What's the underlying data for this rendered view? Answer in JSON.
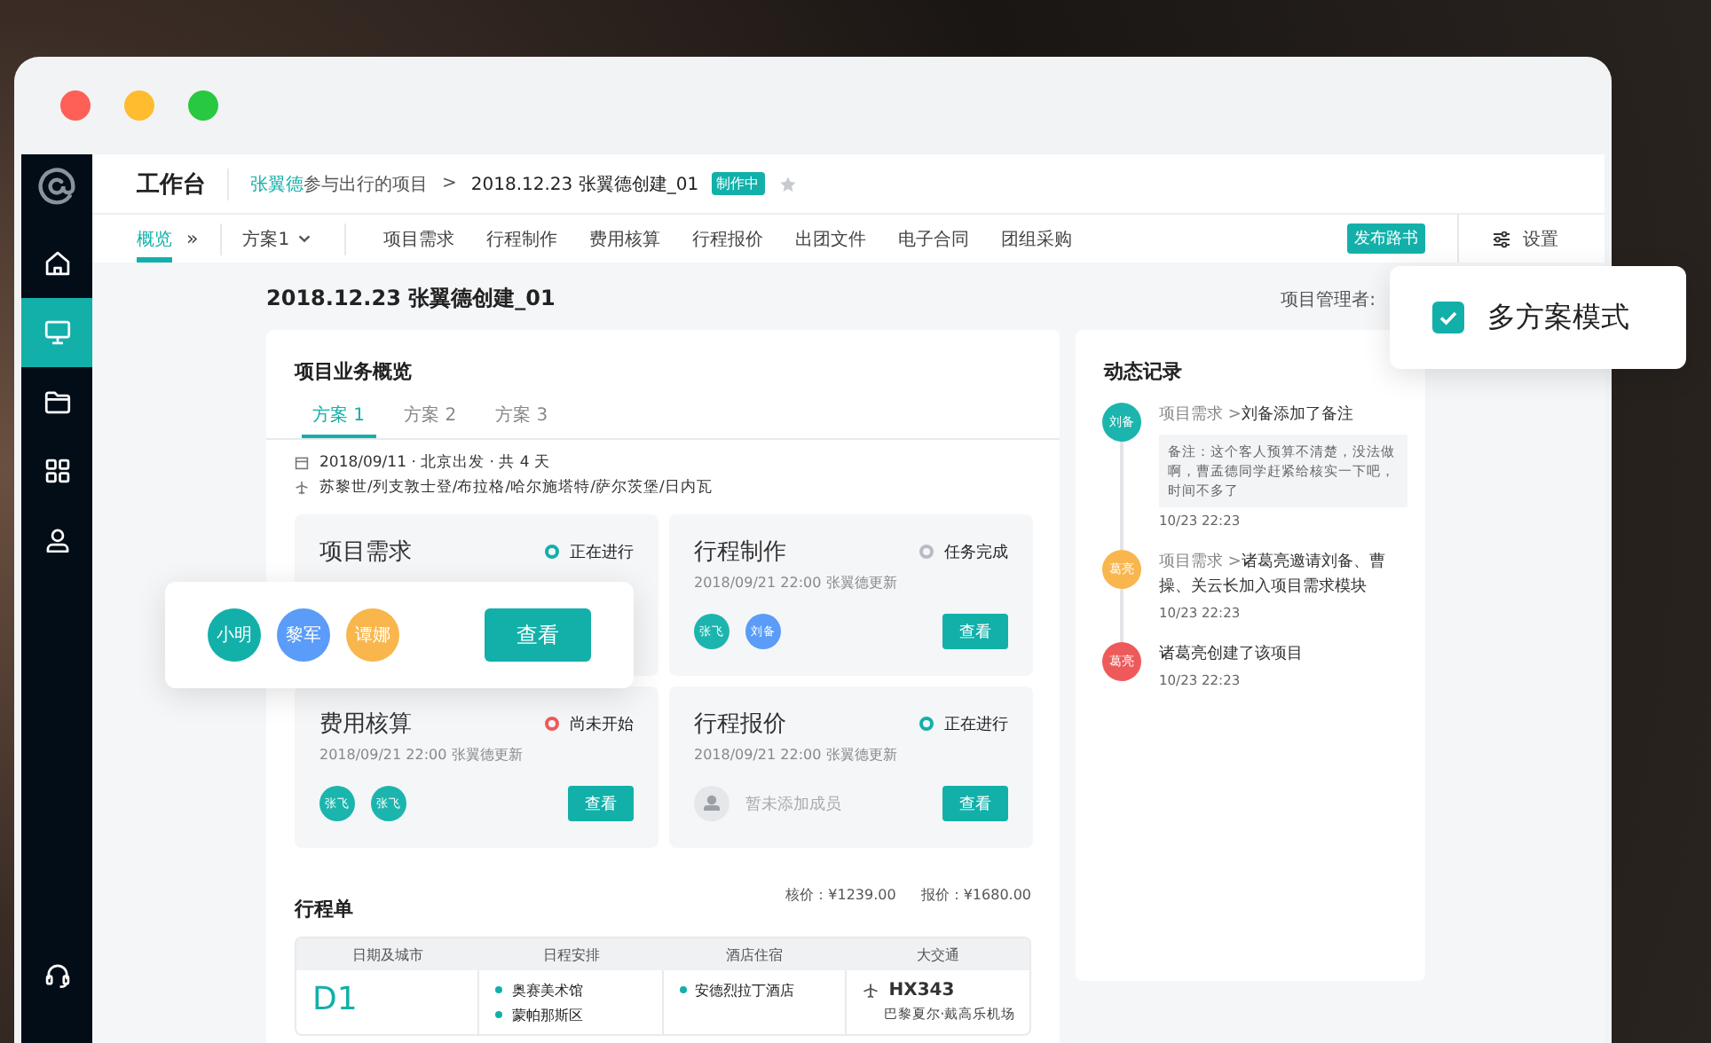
{
  "sidebar": {
    "items": [
      {
        "kind": "home",
        "selected": false
      },
      {
        "kind": "monitor",
        "selected": true
      },
      {
        "kind": "folder",
        "selected": false
      },
      {
        "kind": "grid",
        "selected": false
      },
      {
        "kind": "user",
        "selected": false
      }
    ]
  },
  "header": {
    "title": "工作台",
    "breadcrumb_user": "张翼德",
    "breadcrumb_parent": "参与出行的项目",
    "breadcrumb_separator": ">",
    "breadcrumb_current": "2018.12.23 张翼德创建_01",
    "badge": "制作中",
    "starred": false
  },
  "nav": {
    "overview": {
      "label": "概览",
      "selected": true
    },
    "more": "»",
    "plan_select": "方案1",
    "tabs": [
      {
        "label": "项目需求",
        "selected": false
      },
      {
        "label": "行程制作",
        "selected": false
      },
      {
        "label": "费用核算",
        "selected": false
      },
      {
        "label": "行程报价",
        "selected": false
      },
      {
        "label": "出团文件",
        "selected": false
      },
      {
        "label": "电子合同",
        "selected": false
      },
      {
        "label": "团组采购",
        "selected": false
      }
    ],
    "publish_button": "发布路书",
    "settings": "设置"
  },
  "project": {
    "title": "2018.12.23 张翼德创建_01",
    "manager_label": "项目管理者:"
  },
  "multi_plan": {
    "label": "多方案模式",
    "checked": true
  },
  "overview": {
    "title": "项目业务概览",
    "tabs": [
      {
        "label": "方案 1",
        "selected": true
      },
      {
        "label": "方案 2",
        "selected": false
      },
      {
        "label": "方案 3",
        "selected": false
      }
    ],
    "trip": "2018/09/11 · 北京出发 · 共 4 天",
    "route": "苏黎世/列支敦士登/布拉格/哈尔施塔特/萨尔茨堡/日内瓦",
    "modules": [
      {
        "title": "项目需求",
        "status": "正在进行",
        "color": "#13b0aa"
      },
      {
        "title": "行程制作",
        "status": "任务完成",
        "color": "#b8bcc2",
        "updated": "2018/09/21  22:00  张翼德更新",
        "members": [
          {
            "name": "张飞",
            "color": "#1cb5ae"
          },
          {
            "name": "刘备",
            "color": "#5a9cf8"
          }
        ],
        "button": "查看"
      },
      {
        "title": "费用核算",
        "status": "尚未开始",
        "color": "#ee5a5a",
        "updated": "2018/09/21  22:00  张翼德更新",
        "members": [
          {
            "name": "张飞",
            "color": "#1cb5ae"
          },
          {
            "name": "张飞",
            "color": "#1cb5ae"
          }
        ],
        "button": "查看"
      },
      {
        "title": "行程报价",
        "status": "正在进行",
        "color": "#13b0aa",
        "updated": "2018/09/21  22:00  张翼德更新",
        "empty_members": "暂未添加成员",
        "button": "查看"
      }
    ]
  },
  "popup": {
    "members": [
      {
        "name": "小明",
        "color": "#13b0aa"
      },
      {
        "name": "黎军",
        "color": "#5a9cf8"
      },
      {
        "name": "谭娜",
        "color": "#f8b64c"
      }
    ],
    "button": "查看"
  },
  "itinerary": {
    "title": "行程单",
    "cost_label": "核价：",
    "cost": "¥1239.00",
    "quote_label": "报价：",
    "quote": "¥1680.00",
    "columns": [
      "日期及城市",
      "日程安排",
      "酒店住宿",
      "大交通"
    ],
    "rows": [
      {
        "day": "D1",
        "schedule": [
          "奥赛美术馆",
          "蒙帕那斯区"
        ],
        "hotels": [
          "安德烈拉丁酒店"
        ],
        "flight": "HX343",
        "airport": "巴黎夏尔·戴高乐机场"
      }
    ]
  },
  "activity": {
    "title": "动态记录",
    "entries": [
      {
        "avatar": "刘备",
        "color": "#1cb5ae",
        "path": "项目需求 >",
        "text": "刘备添加了备注",
        "note": "备注：这个客人预算不清楚，没法做啊，曹孟德同学赶紧给核实一下吧，时间不多了",
        "time": "10/23  22:23"
      },
      {
        "avatar": "葛亮",
        "color": "#f8b64c",
        "path": "项目需求 >",
        "text": "诸葛亮邀请刘备、曹操、关云长加入项目需求模块",
        "time": "10/23  22:23"
      },
      {
        "avatar": "葛亮",
        "color": "#ee5a5a",
        "text": "诸葛亮创建了该项目",
        "time": "10/23  22:23"
      }
    ]
  }
}
